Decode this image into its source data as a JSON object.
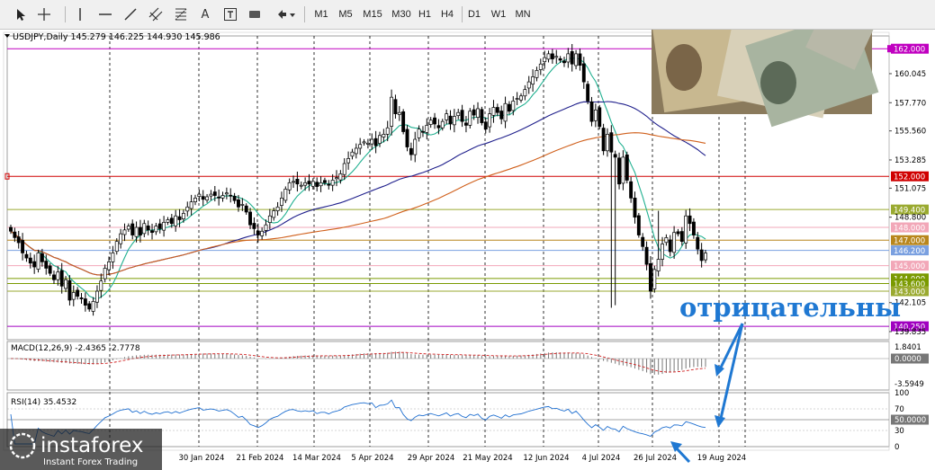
{
  "toolbar": {
    "icons": [
      "cursor-icon",
      "crosshair-icon",
      "vertical-line-icon",
      "horizontal-line-icon",
      "trendline-icon",
      "channel-icon",
      "fibonacci-icon",
      "text-icon",
      "label-icon",
      "rectangle-icon",
      "shapes-icon"
    ],
    "text_tool": "A",
    "label_tool": "T",
    "timeframes": [
      "M1",
      "M5",
      "M15",
      "M30",
      "H1",
      "H4",
      "D1",
      "W1",
      "MN"
    ]
  },
  "chart_header": "USDJPY,Daily  145.279 146.225 144.930 145.986",
  "macd_label": "MACD(12,26,9) -2.4365 -2.7778",
  "rsi_label": "RSI(14) 35.4532",
  "price_scale": [
    "160.045",
    "157.770",
    "155.560",
    "153.285",
    "151.075",
    "148.800",
    "142.105",
    "139.835"
  ],
  "level_tags": [
    {
      "text": "162.000",
      "price": 162.0,
      "color": "#c000c0"
    },
    {
      "text": "152.000",
      "price": 152.0,
      "color": "#d00000"
    },
    {
      "text": "149.400",
      "price": 149.4,
      "color": "#9aaa30"
    },
    {
      "text": "148.000",
      "price": 148.0,
      "color": "#f2a7b8"
    },
    {
      "text": "147.000",
      "price": 147.0,
      "color": "#b8861c"
    },
    {
      "text": "146.200",
      "price": 146.2,
      "color": "#7aa0e0"
    },
    {
      "text": "145.000",
      "price": 145.0,
      "color": "#f2a7b8"
    },
    {
      "text": "144.000",
      "price": 144.0,
      "color": "#7a9a00"
    },
    {
      "text": "143.600",
      "price": 143.6,
      "color": "#7a9a00"
    },
    {
      "text": "143.000",
      "price": 143.0,
      "color": "#9aaa30"
    },
    {
      "text": "140.250",
      "price": 140.25,
      "color": "#a000c0"
    }
  ],
  "macd_scale": [
    "1.8401",
    "0.0000",
    "-3.5949"
  ],
  "rsi_scale": [
    "100",
    "70",
    "50.0000",
    "30",
    "0"
  ],
  "date_labels": [
    "30 Jan 2024",
    "21 Feb 2024",
    "14 Mar 2024",
    "5 Apr 2024",
    "29 Apr 2024",
    "21 May 2024",
    "12 Jun 2024",
    "4 Jul 2024",
    "26 Jul 2024",
    "19 Aug 2024"
  ],
  "annotation": "отрицательны",
  "watermark": {
    "brand": "instaforex",
    "tagline": "Instant Forex Trading"
  },
  "colors": {
    "bull": "#ffffff",
    "bear": "#000000",
    "ma_fast": "#20b090",
    "ma_mid": "#20208c",
    "ma_slow": "#d0601c",
    "annotation": "#1f78d2",
    "macd_signal": "#d02020"
  },
  "chart_data": {
    "type": "candlestick",
    "symbol": "USDJPY",
    "timeframe": "Daily",
    "ohlc_last": {
      "open": 145.279,
      "high": 146.225,
      "low": 144.93,
      "close": 145.986
    },
    "ylim": [
      139.2,
      163.0
    ],
    "dates": [
      "30 Jan 2024",
      "21 Feb 2024",
      "14 Mar 2024",
      "5 Apr 2024",
      "29 Apr 2024",
      "21 May 2024",
      "12 Jun 2024",
      "4 Jul 2024",
      "26 Jul 2024",
      "19 Aug 2024"
    ],
    "closes": [
      147.7,
      147.2,
      146.8,
      146.0,
      145.6,
      145.2,
      144.9,
      146.0,
      145.3,
      144.8,
      144.4,
      143.9,
      144.5,
      143.4,
      143.9,
      142.3,
      142.9,
      142.6,
      142.4,
      141.9,
      141.6,
      142.2,
      143.0,
      143.8,
      144.8,
      145.3,
      146.0,
      146.9,
      147.5,
      147.8,
      148.1,
      147.4,
      148.0,
      147.4,
      148.3,
      147.8,
      147.6,
      148.1,
      147.9,
      148.4,
      148.6,
      148.3,
      148.9,
      148.6,
      149.1,
      149.6,
      150.0,
      150.3,
      150.6,
      150.2,
      150.4,
      150.6,
      150.5,
      150.3,
      150.5,
      150.7,
      150.5,
      150.1,
      149.6,
      149.8,
      149.2,
      148.2,
      147.9,
      147.4,
      147.7,
      148.2,
      148.9,
      149.3,
      149.6,
      150.3,
      151.0,
      151.5,
      151.6,
      151.4,
      151.3,
      151.5,
      151.4,
      151.6,
      151.2,
      151.5,
      151.5,
      151.3,
      151.7,
      151.9,
      152.2,
      153.0,
      153.4,
      153.9,
      154.2,
      154.5,
      154.7,
      154.6,
      154.9,
      154.4,
      155.2,
      155.3,
      155.8,
      158.2,
      156.9,
      157.0,
      155.5,
      154.3,
      153.7,
      154.9,
      155.7,
      155.5,
      156.0,
      156.4,
      156.1,
      155.8,
      156.3,
      156.9,
      156.1,
      156.7,
      157.0,
      156.3,
      156.0,
      157.1,
      156.8,
      157.3,
      156.2,
      155.7,
      156.9,
      157.4,
      157.0,
      156.5,
      157.7,
      157.1,
      157.9,
      158.1,
      158.3,
      158.8,
      159.4,
      159.8,
      160.3,
      160.8,
      161.3,
      161.6,
      161.2,
      161.4,
      161.1,
      160.9,
      161.6,
      160.8,
      161.6,
      160.7,
      159.4,
      157.9,
      156.3,
      157.2,
      155.9,
      154.0,
      155.3,
      153.9,
      153.5,
      151.4,
      153.5,
      151.7,
      150.3,
      148.8,
      147.4,
      146.5,
      145.1,
      143.0,
      144.7,
      145.5,
      146.7,
      147.2,
      146.1,
      147.6,
      147.5,
      146.9,
      148.9,
      148.3,
      147.4,
      146.3,
      145.4,
      145.986
    ],
    "ma_fast": {
      "name": "",
      "type": "line"
    },
    "ma_mid": {
      "name": "",
      "type": "line"
    },
    "ma_slow": {
      "name": "",
      "type": "line"
    },
    "horizontal_levels": [
      162.0,
      152.0,
      149.4,
      148.0,
      147.0,
      146.2,
      145.0,
      144.0,
      143.6,
      143.0,
      140.25
    ],
    "macd": {
      "value": -2.4365,
      "signal": -2.7778,
      "params": "12,26,9",
      "ylim": [
        -3.5949,
        1.8401
      ]
    },
    "rsi": {
      "value": 35.4532,
      "period": 14,
      "ylim": [
        0,
        100
      ],
      "levels": [
        30,
        50,
        70
      ]
    },
    "grid": "vertical dashed at date labels",
    "annotation_text": "отрицательны"
  }
}
